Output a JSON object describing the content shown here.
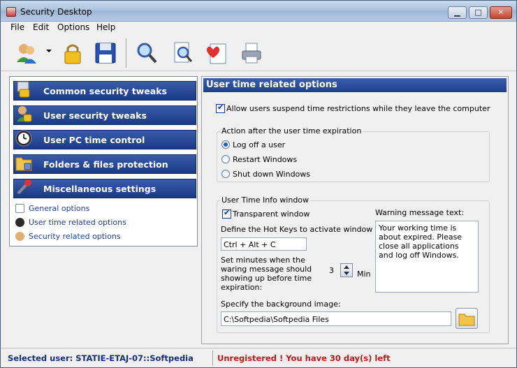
{
  "window": {
    "title": "Security Desktop",
    "buttons": {
      "minimize": "▁",
      "maximize": "□",
      "close": "✕"
    }
  },
  "menu": {
    "items": [
      "File",
      "Edit",
      "Options",
      "Help"
    ]
  },
  "toolbar": {
    "icons": [
      "users-icon",
      "lock-icon",
      "save-icon",
      "search-icon",
      "search-document-icon",
      "heart-document-icon",
      "print-icon"
    ]
  },
  "sidebar": {
    "categories": [
      {
        "label": "Common security tweaks",
        "icon": "lock-icon"
      },
      {
        "label": "User security tweaks",
        "icon": "user-lock-icon"
      },
      {
        "label": "User PC time control",
        "icon": "clock-icon"
      },
      {
        "label": "Folders & files protection",
        "icon": "folder-lock-icon"
      },
      {
        "label": "Miscellaneous settings",
        "icon": "wrench-icon"
      }
    ],
    "subitems": [
      {
        "label": "General options",
        "icon": "document-icon"
      },
      {
        "label": "User time related options",
        "icon": "clock-icon"
      },
      {
        "label": "Security related options",
        "icon": "users-icon"
      }
    ]
  },
  "main": {
    "title": "User time related options",
    "allow_suspend": {
      "label": "Allow users suspend time restrictions while they leave the computer",
      "checked": true
    },
    "action_group": {
      "title": "Action after the user time expiration",
      "options": [
        "Log off  a user",
        "Restart Windows",
        "Shut down Windows"
      ],
      "selected": 0
    },
    "info_group": {
      "title": "User Time Info window",
      "transparent": {
        "label": "Transparent window",
        "checked": true
      },
      "hotkeys_label": "Define the Hot Keys to activate window",
      "hotkeys_value": "Ctrl + Alt + C",
      "minutes_label_1": "Set minutes when the",
      "minutes_label_2": "waring message should",
      "minutes_label_3": "showing up before time",
      "minutes_label_4": "expiration:",
      "minutes_value": "3",
      "minutes_unit": "Min",
      "warning_label": "Warning message text:",
      "warning_text": "Your working time is about expired. Please close all applications and log off Windows.",
      "bg_label": "Specify the background image:",
      "bg_path": "C:\\Softpedia\\Softpedia Files"
    }
  },
  "status": {
    "selected_user": "Selected user: STATIE-ETAJ-07::Softpedia",
    "registration": "Unregistered ! You have 30 day(s) left"
  },
  "colors": {
    "accent": "#1f3f8c",
    "link": "#1f3e9a",
    "warning": "#c01818"
  }
}
